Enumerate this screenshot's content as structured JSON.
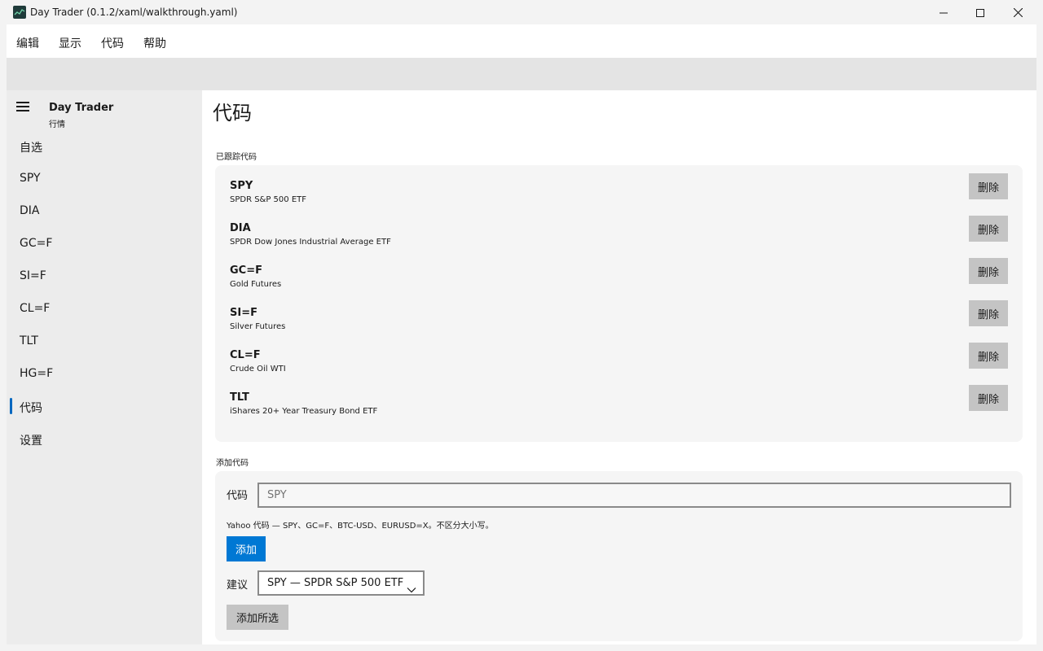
{
  "window": {
    "title": "Day Trader (0.1.2/xaml/walkthrough.yaml)",
    "minimize_icon": "minimize-icon",
    "maximize_icon": "maximize-icon",
    "close_icon": "close-icon"
  },
  "menu": [
    "编辑",
    "显示",
    "代码",
    "帮助"
  ],
  "sidebar": {
    "title": "Day Trader",
    "subtitle": "行情",
    "menu_icon": "hamburger-icon",
    "items": [
      {
        "label": "自选"
      },
      {
        "label": "SPY"
      },
      {
        "label": "DIA"
      },
      {
        "label": "GC=F"
      },
      {
        "label": "SI=F"
      },
      {
        "label": "CL=F"
      },
      {
        "label": "TLT"
      },
      {
        "label": "HG=F"
      },
      {
        "label": "代码",
        "selected": true
      },
      {
        "label": "设置"
      }
    ],
    "accent": "#0067c0"
  },
  "page": {
    "title": "代码",
    "tracked_label": "已跟踪代码",
    "delete_label": "删除",
    "tracked": [
      {
        "symbol": "SPY",
        "name": "SPDR S&P 500 ETF"
      },
      {
        "symbol": "DIA",
        "name": "SPDR Dow Jones Industrial Average ETF"
      },
      {
        "symbol": "GC=F",
        "name": "Gold Futures"
      },
      {
        "symbol": "SI=F",
        "name": "Silver Futures"
      },
      {
        "symbol": "CL=F",
        "name": "Crude Oil WTI"
      },
      {
        "symbol": "TLT",
        "name": "iShares 20+ Year Treasury Bond ETF"
      }
    ],
    "add_section": {
      "label": "添加代码",
      "field_label": "代码",
      "placeholder": "SPY",
      "hint": "Yahoo 代码 — SPY、GC=F、BTC-USD、EURUSD=X。不区分大小写。",
      "add_button": "添加",
      "suggest_label": "建议",
      "suggest_value": "SPY — SPDR S&P 500 ETF",
      "add_selected_button": "添加所选"
    }
  },
  "colors": {
    "primary_button": "#0078d4",
    "secondary_button": "#c4c4c4"
  }
}
